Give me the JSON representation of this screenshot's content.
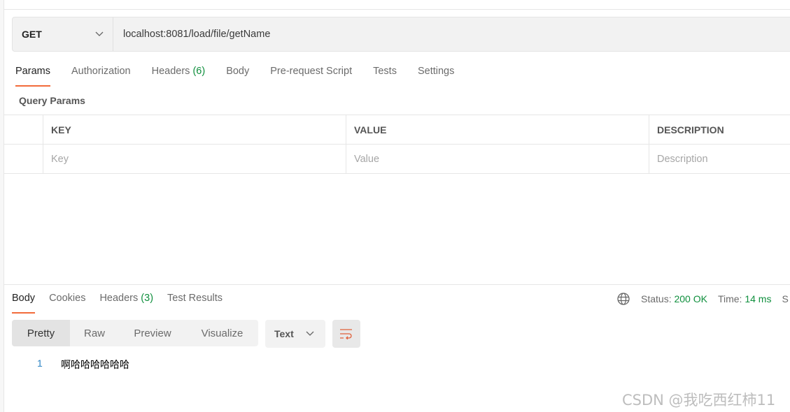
{
  "request": {
    "method": "GET",
    "url": "localhost:8081/load/file/getName"
  },
  "tabs": [
    {
      "label": "Params"
    },
    {
      "label": "Authorization"
    },
    {
      "label": "Headers",
      "count": "(6)"
    },
    {
      "label": "Body"
    },
    {
      "label": "Pre-request Script"
    },
    {
      "label": "Tests"
    },
    {
      "label": "Settings"
    }
  ],
  "query_params": {
    "title": "Query Params",
    "headers": [
      "KEY",
      "VALUE",
      "DESCRIPTION"
    ],
    "placeholders": [
      "Key",
      "Value",
      "Description"
    ]
  },
  "response": {
    "tabs": [
      {
        "label": "Body"
      },
      {
        "label": "Cookies"
      },
      {
        "label": "Headers",
        "count": "(3)"
      },
      {
        "label": "Test Results"
      }
    ],
    "status_label": "Status:",
    "status": "200 OK",
    "time_label": "Time:",
    "time": "14 ms",
    "truncated": "S",
    "views": [
      "Pretty",
      "Raw",
      "Preview",
      "Visualize"
    ],
    "format": "Text",
    "lines": [
      {
        "n": "1",
        "text": "啊哈哈哈哈哈哈"
      }
    ]
  },
  "colors": {
    "accent": "#f26b3a",
    "success": "#0f8f3d"
  },
  "watermark": "CSDN @我吃西红柿11"
}
